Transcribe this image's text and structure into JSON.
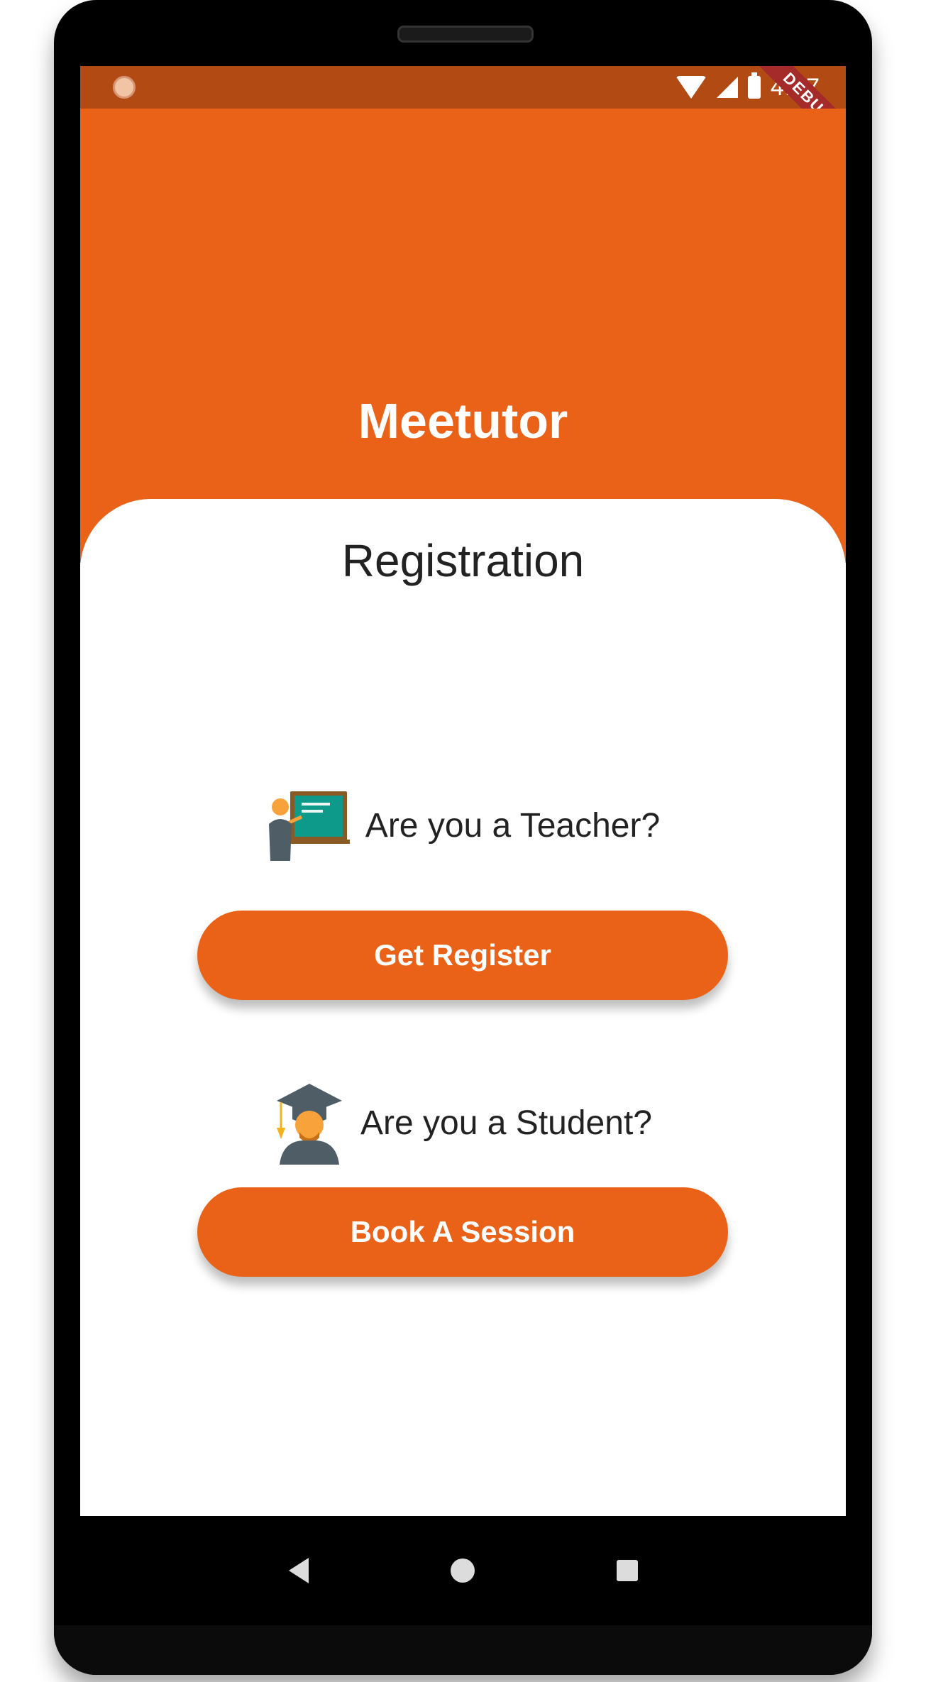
{
  "status_bar": {
    "time": "4:17",
    "debug_label": "DEBUG"
  },
  "header": {
    "title": "Meetutor"
  },
  "registration": {
    "title": "Registration",
    "teacher_prompt": "Are you a Teacher?",
    "teacher_button": "Get Register",
    "student_prompt": "Are you a Student?",
    "student_button": "Book A Session"
  },
  "colors": {
    "accent": "#e96218",
    "status_bar": "#b24a13"
  },
  "icons": [
    "teacher-icon",
    "student-icon",
    "wifi-icon",
    "signal-icon",
    "battery-icon",
    "back-icon",
    "home-icon",
    "recents-icon"
  ]
}
